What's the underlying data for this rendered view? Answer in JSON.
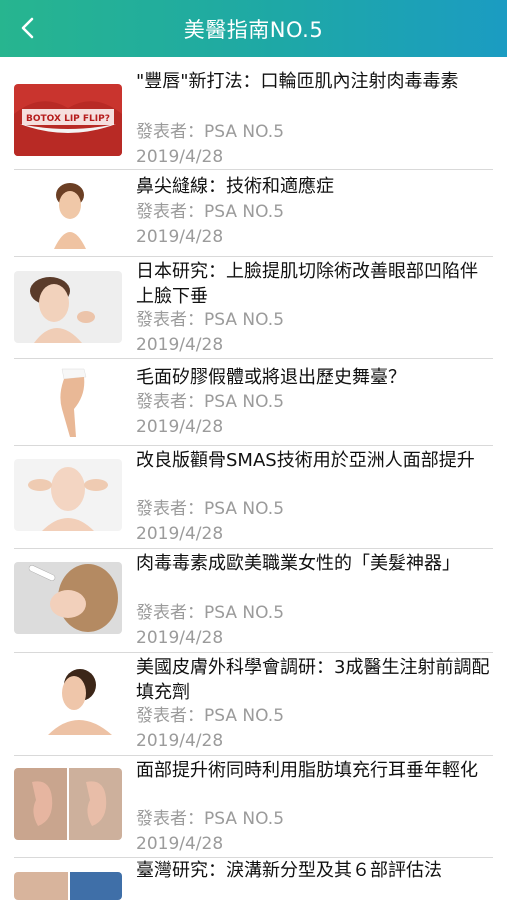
{
  "header": {
    "title": "美醫指南NO.5"
  },
  "articles": [
    {
      "title": "\"豐唇\"新打法：口輪匝肌內注射肉毒毒素",
      "author": "發表者：PSA NO.5",
      "date": "2019/4/28",
      "thumb_text": "BOTOX LIP FLIP?"
    },
    {
      "title": "鼻尖縫線：技術和適應症",
      "author": "發表者：PSA NO.5",
      "date": "2019/4/28"
    },
    {
      "title": "日本研究：上臉提肌切除術改善眼部凹陷伴上臉下垂",
      "author": "發表者：PSA NO.5",
      "date": "2019/4/28"
    },
    {
      "title": "毛面矽膠假體或將退出歷史舞臺？",
      "author": "發表者：PSA NO.5",
      "date": "2019/4/28"
    },
    {
      "title": "改良版顴骨SMAS技術用於亞洲人面部提升",
      "author": "發表者：PSA NO.5",
      "date": "2019/4/28"
    },
    {
      "title": "肉毒毒素成歐美職業女性的「美髮神器」",
      "author": "發表者：PSA NO.5",
      "date": "2019/4/28"
    },
    {
      "title": "美國皮膚外科學會調研：3成醫生注射前調配填充劑",
      "author": "發表者：PSA NO.5",
      "date": "2019/4/28"
    },
    {
      "title": "面部提升術同時利用脂肪填充行耳垂年輕化",
      "author": "發表者：PSA NO.5",
      "date": "2019/4/28"
    },
    {
      "title": "臺灣研究：淚溝新分型及其６部評估法",
      "author": "",
      "date": ""
    }
  ]
}
